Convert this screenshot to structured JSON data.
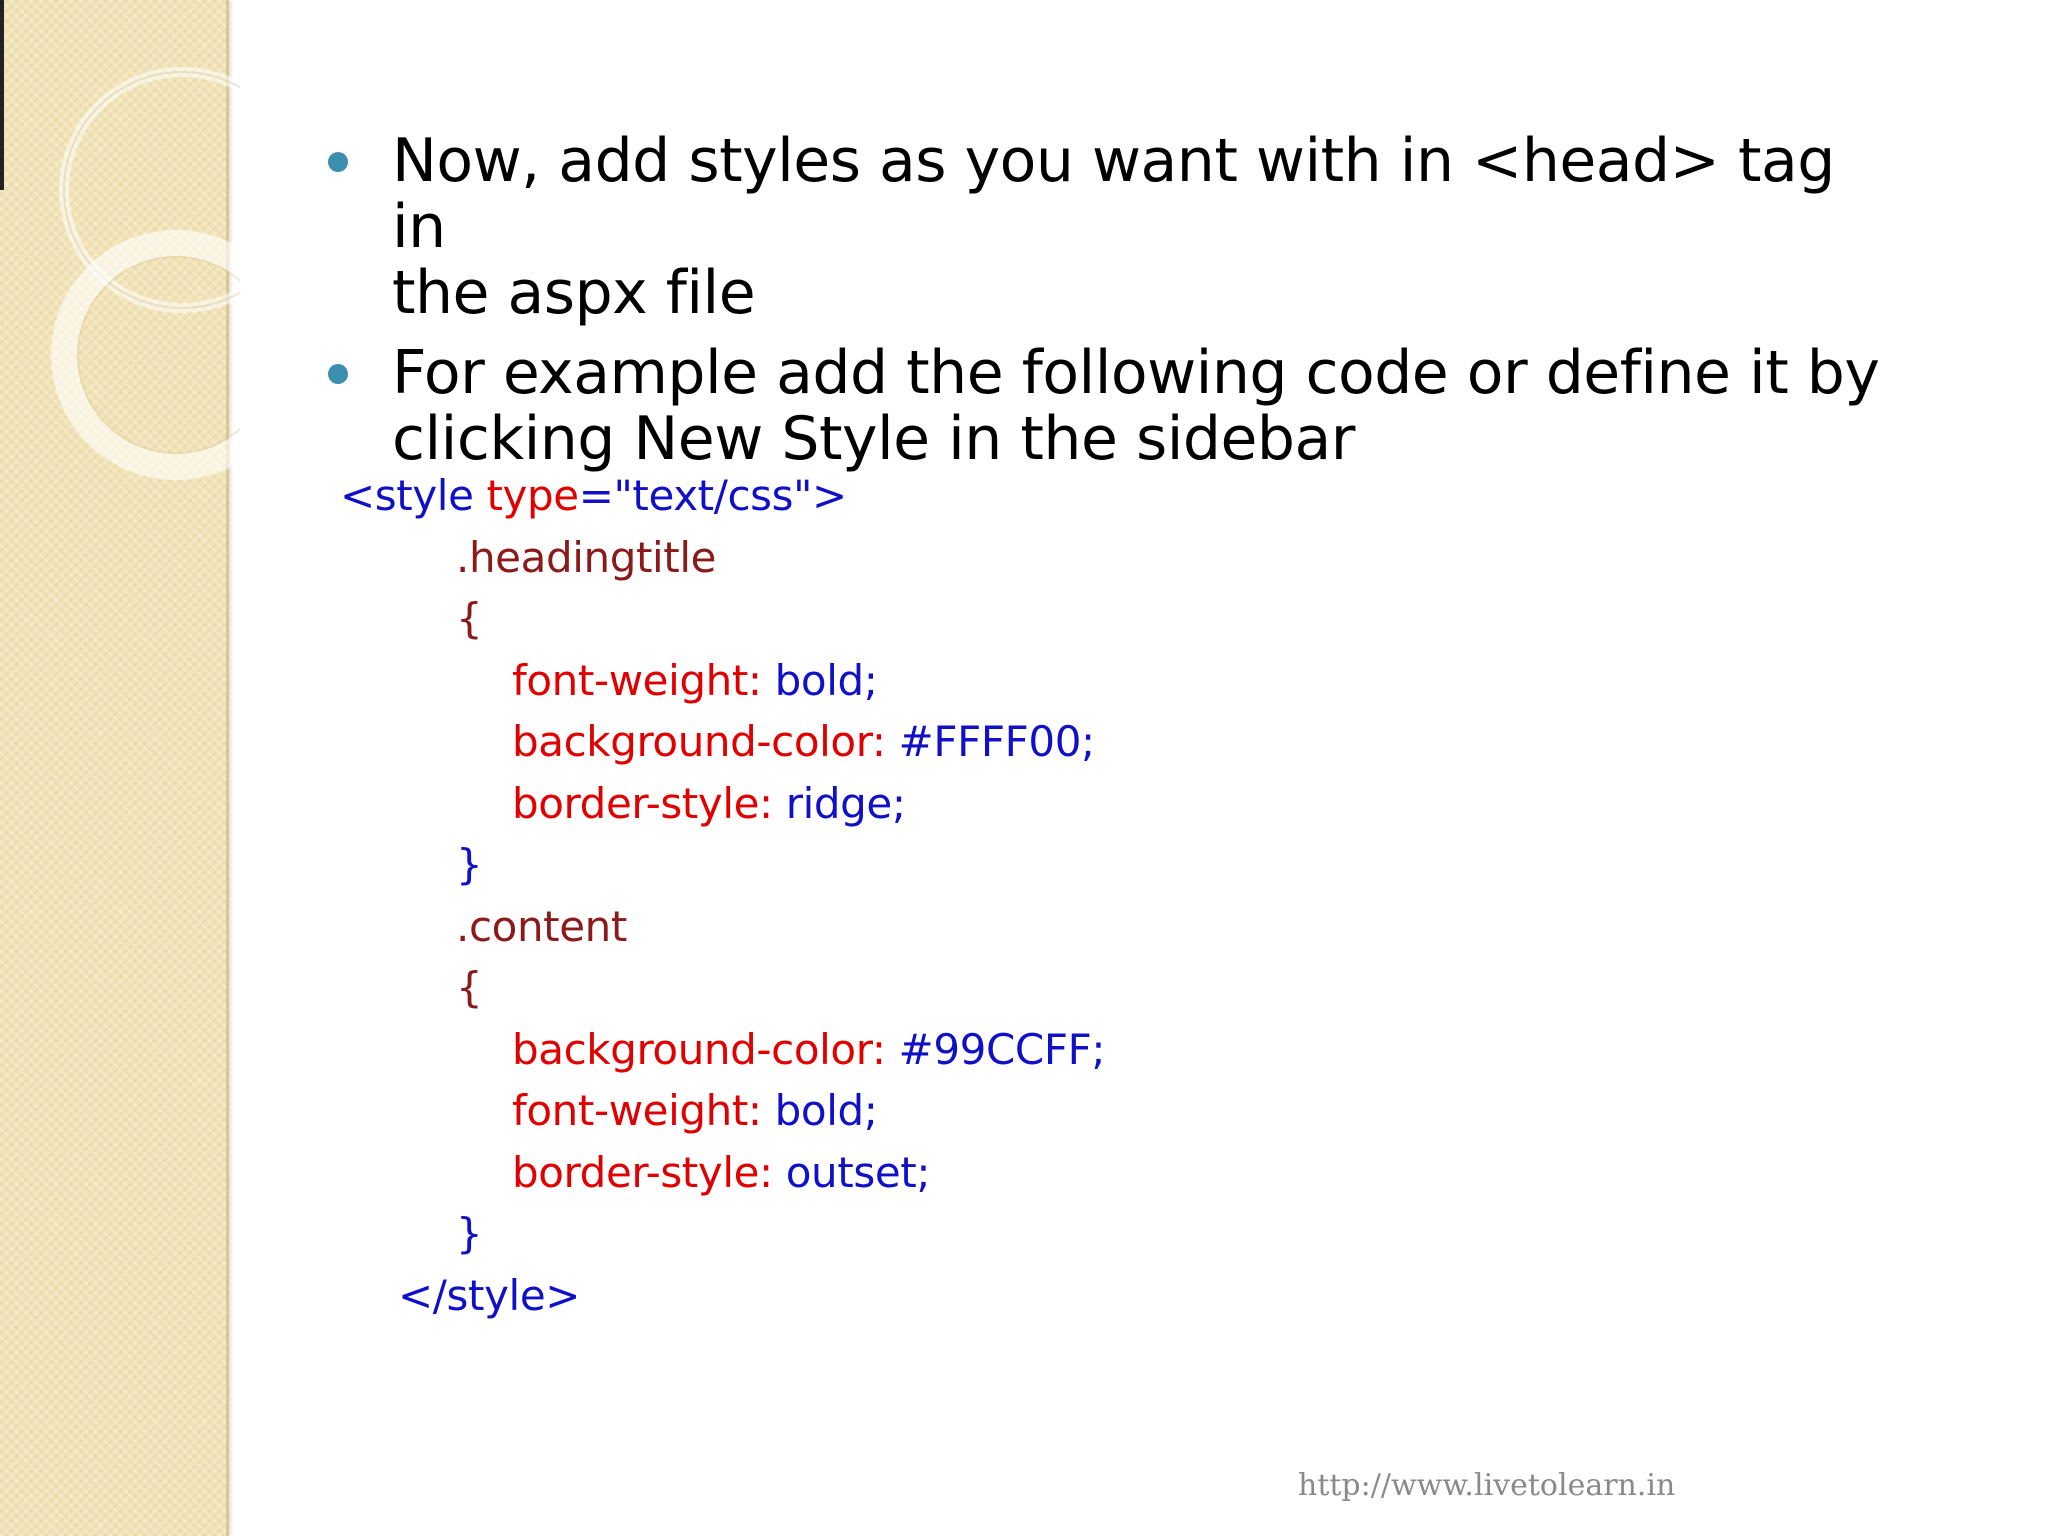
{
  "bullets": [
    {
      "line1": "Now, add styles as you want with in <head> tag in",
      "line2": "the aspx file"
    },
    {
      "line1": "For example add the following code or define it by",
      "line2": "clicking New Style in the sidebar"
    }
  ],
  "code": {
    "open_tag_start": "<style ",
    "open_tag_attr": "type",
    "open_tag_eq": "=",
    "open_tag_val": "\"text/css\">",
    "rule1_selector": ".headingtitle",
    "brace_open": "{",
    "brace_close": "}",
    "rule1": [
      {
        "prop": "font-weight:",
        "value": " bold;"
      },
      {
        "prop": "background-color:",
        "value": " #FFFF00;"
      },
      {
        "prop": "border-style:",
        "value": " ridge;"
      }
    ],
    "rule2_selector": ".content",
    "rule2": [
      {
        "prop": "background-color:",
        "value": " #99CCFF;"
      },
      {
        "prop": "font-weight:",
        "value": " bold;"
      },
      {
        "prop": "border-style:",
        "value": " outset;"
      }
    ],
    "close_tag": "</style>"
  },
  "footer": {
    "url": "http://www.livetolearn.in"
  },
  "colors": {
    "bullet": "#3d8fb0",
    "tag_blue": "#1010c8",
    "selector_maroon": "#8b1a1a",
    "property_red": "#e00000",
    "side_band": "#f2e4b7"
  }
}
